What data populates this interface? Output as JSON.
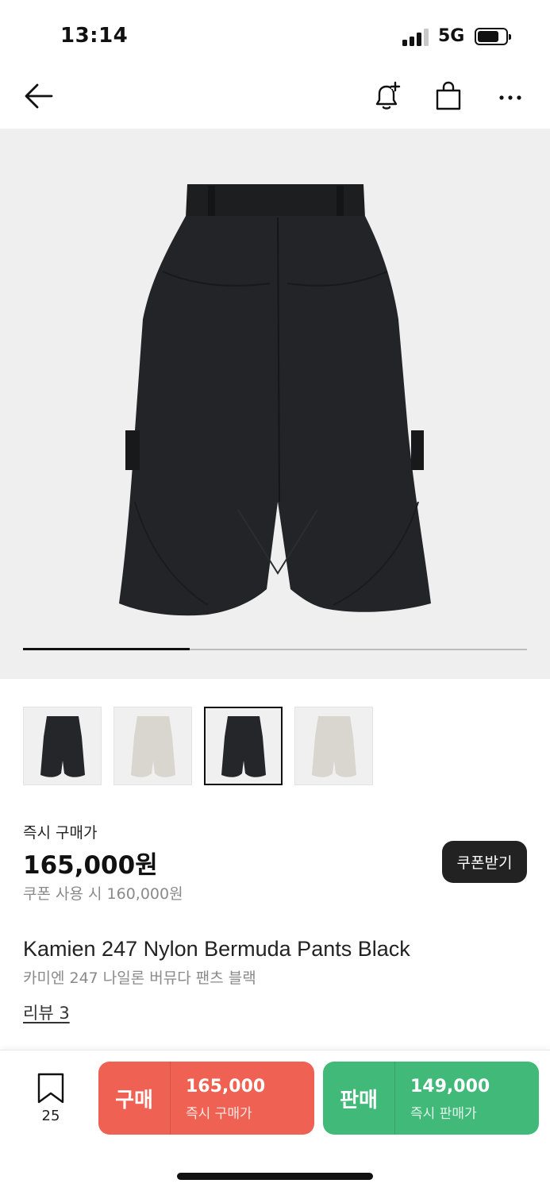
{
  "status_bar": {
    "time": "13:14",
    "network": "5G",
    "battery_level": 0.7
  },
  "nav": {
    "back_icon": "arrow-left-icon",
    "alert_icon": "bell-plus-icon",
    "bag_icon": "shopping-bag-icon",
    "more_icon": "more-horizontal-icon"
  },
  "hero": {
    "image_index_progress": 0.33
  },
  "thumbnails": [
    {
      "color": "black",
      "selected": false
    },
    {
      "color": "beige",
      "selected": false
    },
    {
      "color": "black",
      "selected": true
    },
    {
      "color": "beige",
      "selected": false
    }
  ],
  "price": {
    "label": "즉시 구매가",
    "value": "165,000원",
    "coupon_note": "쿠폰 사용 시 160,000원",
    "coupon_button": "쿠폰받기"
  },
  "product": {
    "name_en": "Kamien 247 Nylon Bermuda Pants Black",
    "name_ko": "카미엔 247 나일론 버뮤다 팬츠 블랙",
    "review_link": "리뷰 3"
  },
  "bottom_bar": {
    "bookmark_count": "25",
    "buy": {
      "label": "구매",
      "amount": "165,000",
      "sub": "즉시 구매가",
      "color": "#ef6253"
    },
    "sell": {
      "label": "판매",
      "amount": "149,000",
      "sub": "즉시 판매가",
      "color": "#41b979"
    }
  },
  "colors": {
    "buy": "#ef6253",
    "sell": "#41b979",
    "coupon_bg": "#222222",
    "hero_bg": "#efefef"
  }
}
